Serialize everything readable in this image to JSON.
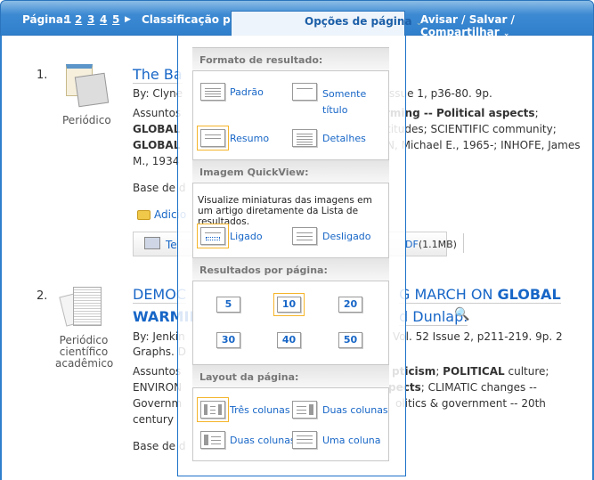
{
  "topbar": {
    "page_label": "Página:",
    "pages": [
      "1",
      "2",
      "3",
      "4",
      "5"
    ],
    "sort": "Classificação por relevância",
    "page_options": "Opções de página",
    "alert": "Avisar / Salvar / Compartilhar"
  },
  "results": [
    {
      "num": "1.",
      "type": "Periódico",
      "title": "The Ba",
      "by": "By: Clyne",
      "by_r": "ssue 1, p36-80. 9p.",
      "subj": "Assuntos",
      "subj_r1": "rming -- ",
      "subj_r1b": "Political aspects",
      "subj_r1c": ";",
      "l2": "GLOBAL",
      "l2_r": "titudes; SCIENTIFIC community;",
      "l3": "GLOBAL",
      "l3_r": "N, Michael E., 1965-; INHOFE, James",
      "l4": "M., 1934",
      "db": "Base de d",
      "add": "Adicio",
      "full": "Te",
      "pdf": "DF",
      "pdf_size": "(1.1MB)"
    },
    {
      "num": "2.",
      "type": "Periódico científico acadêmico",
      "title_a": "DEMOC",
      "title_ar": "G MARCH ON ",
      "title_arb": "GLOBAL",
      "title_b": "WARMIN",
      "title_br": "d Dunlap.",
      "by": "By: Jenkin",
      "by_r": "Vol. 52 Issue 2, p211-219. 9p. 2",
      "l2": "Graphs. D",
      "subj": "Assuntos",
      "subj_r": "pticism",
      "subj_r2": "; ",
      "subj_r3": "POLITICAL",
      "subj_r4": " culture;",
      "l3": "ENVIRON",
      "l3_r": "pects",
      "l3_r2": "; CLIMATIC changes --",
      "l4": "Governm",
      "l4_r": "olitics & government -- 20th",
      "l5": "century",
      "db": "Base de d"
    }
  ],
  "panel": {
    "format": {
      "heading": "Formato de resultado:",
      "options": [
        "Padrão",
        "Somente título",
        "Resumo",
        "Detalhes"
      ],
      "selected": "Resumo"
    },
    "quickview": {
      "heading": "Imagem QuickView:",
      "desc": "Visualize miniaturas das imagens em um artigo diretamente da Lista de resultados.",
      "options": [
        "Ligado",
        "Desligado"
      ],
      "selected": "Ligado"
    },
    "per_page": {
      "heading": "Resultados por página:",
      "options": [
        "5",
        "10",
        "20",
        "30",
        "40",
        "50"
      ],
      "selected": "10"
    },
    "layout": {
      "heading": "Layout da página:",
      "options": [
        "Três colunas",
        "Duas colunas",
        "Duas colunas",
        "Uma coluna"
      ],
      "selected": "Três colunas"
    }
  },
  "colors": {
    "accent": "#2f7fcc",
    "link": "#1766c7",
    "selected": "#f5b52a"
  }
}
